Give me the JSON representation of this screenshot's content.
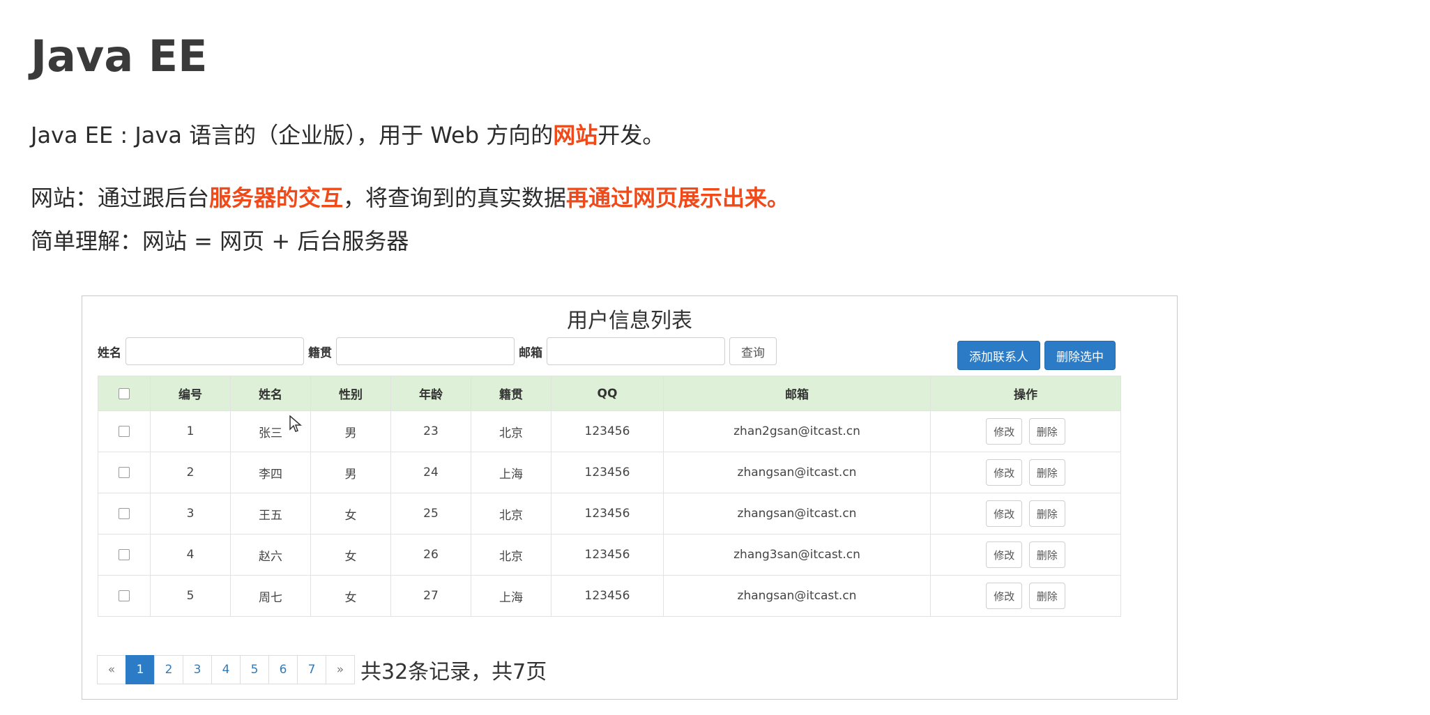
{
  "title": "Java EE",
  "lines": {
    "l1": {
      "text": "Java EE : Java 语言的（企业版），用于 Web 方向的",
      "highlight": "网站",
      "tail": "开发。"
    },
    "l2": {
      "prefix": "网站：通过跟后台",
      "highlight1": "服务器的交互",
      "middle": "，将查询到的真实数据",
      "highlight2": "再通过网页展示出来。"
    },
    "l3": {
      "text": "简单理解：网站 = 网页 + 后台服务器"
    }
  },
  "colors": {
    "highlight": "#f04a1a",
    "primary": "#2b7bc7",
    "header_bg": "#dff0d8"
  },
  "web_page": {
    "heading": "用户信息列表",
    "search": {
      "name_label": "姓名",
      "origin_label": "籍贯",
      "email_label": "邮箱",
      "name_value": "",
      "origin_value": "",
      "email_value": "",
      "query_button": "查询"
    },
    "add_button": "添加联系人",
    "delete_selected_button": "删除选中",
    "table": {
      "headers": [
        "编号",
        "姓名",
        "性别",
        "年龄",
        "籍贯",
        "QQ",
        "邮箱",
        "操作"
      ],
      "rows": [
        {
          "id": "1",
          "name": "张三",
          "gender": "男",
          "age": "23",
          "origin": "北京",
          "qq": "123456",
          "email": "zhan2gsan@itcast.cn"
        },
        {
          "id": "2",
          "name": "李四",
          "gender": "男",
          "age": "24",
          "origin": "上海",
          "qq": "123456",
          "email": "zhangsan@itcast.cn"
        },
        {
          "id": "3",
          "name": "王五",
          "gender": "女",
          "age": "25",
          "origin": "北京",
          "qq": "123456",
          "email": "zhangsan@itcast.cn"
        },
        {
          "id": "4",
          "name": "赵六",
          "gender": "女",
          "age": "26",
          "origin": "北京",
          "qq": "123456",
          "email": "zhang3san@itcast.cn"
        },
        {
          "id": "5",
          "name": "周七",
          "gender": "女",
          "age": "27",
          "origin": "上海",
          "qq": "123456",
          "email": "zhangsan@itcast.cn"
        }
      ],
      "edit_label": "修改",
      "delete_label": "删除"
    },
    "pagination": {
      "prev": "«",
      "pages": [
        "1",
        "2",
        "3",
        "4",
        "5",
        "6",
        "7"
      ],
      "active_page": "1",
      "next": "»",
      "summary": "共32条记录，共7页"
    }
  }
}
